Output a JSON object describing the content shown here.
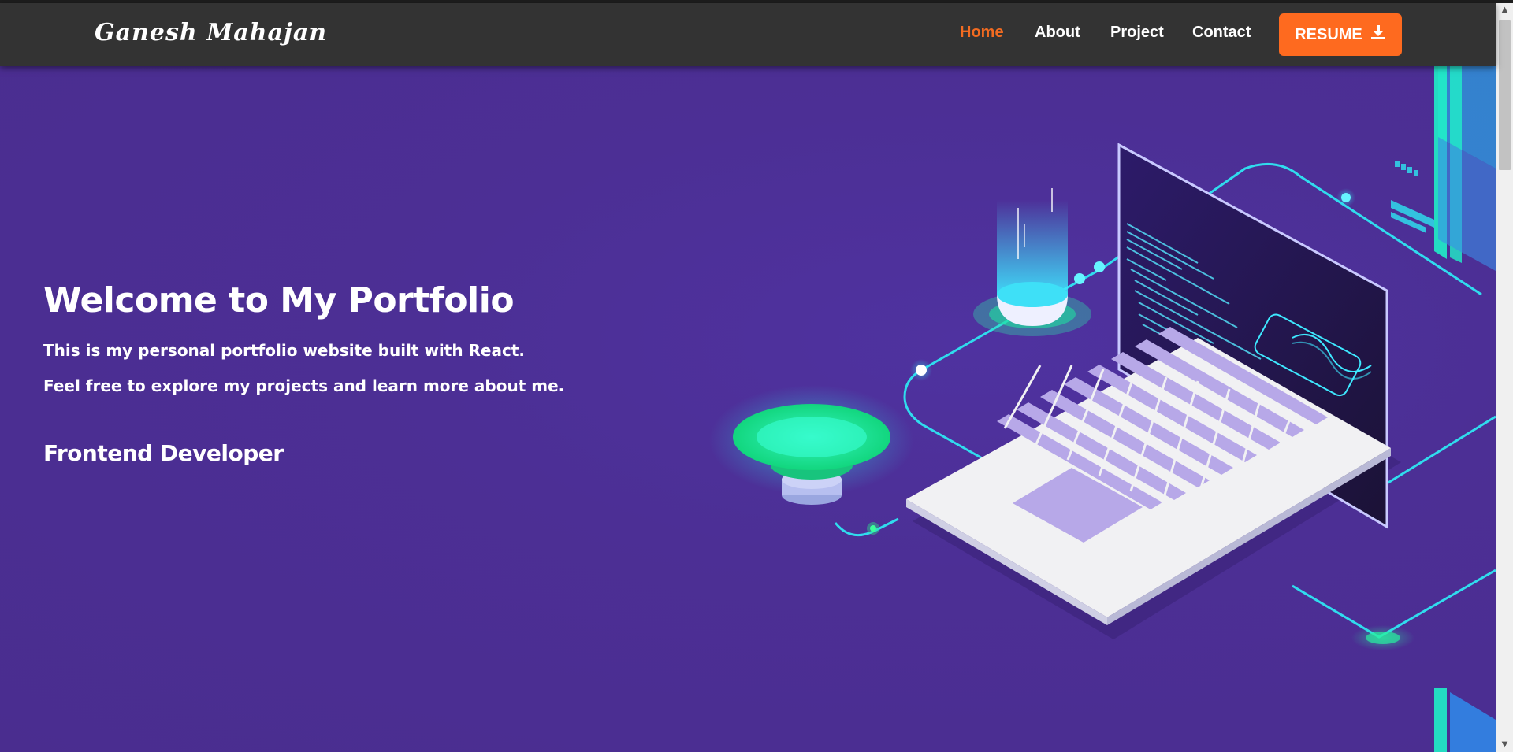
{
  "navbar": {
    "brand": "Ganesh Mahajan",
    "links": [
      {
        "label": "Home",
        "active": true
      },
      {
        "label": "About",
        "active": false
      },
      {
        "label": "Project",
        "active": false
      },
      {
        "label": "Contact",
        "active": false
      }
    ],
    "resume_label": "RESUME",
    "resume_icon": "download-icon"
  },
  "hero": {
    "title": "Welcome to My Portfolio",
    "line1": "This is my personal portfolio website built with React.",
    "line2": "Feel free to explore my projects and learn more about me.",
    "role": "Frontend Developer",
    "illustration": "isometric-laptop-illustration"
  },
  "colors": {
    "navbar_bg": "#333333",
    "accent": "#fe6a1f",
    "hero_bg": "#4b2e91",
    "cyan_glow": "#2ee6f2",
    "green_glow": "#22e89a"
  }
}
